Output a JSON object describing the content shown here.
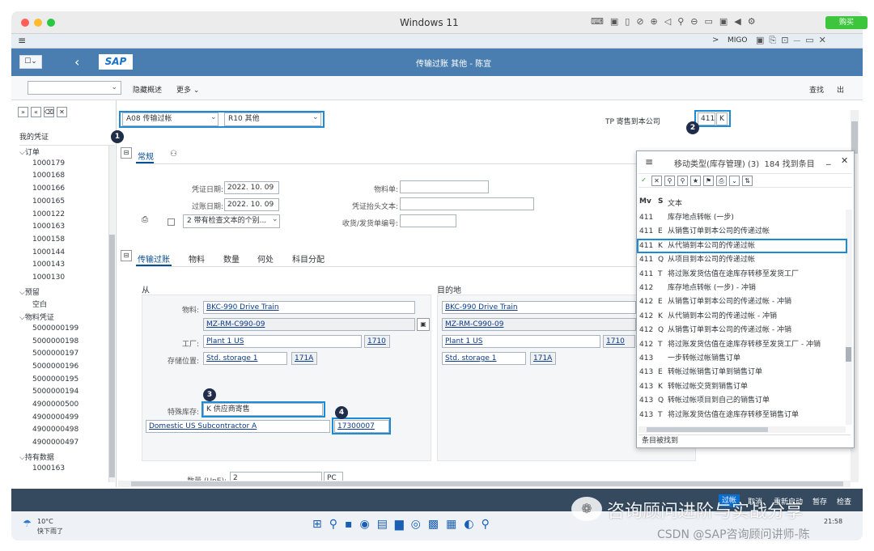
{
  "mac": {
    "title": "Windows 11",
    "buy_label": "购买"
  },
  "sapbar": {
    "tcode": "MIGO"
  },
  "header": {
    "title": "传输过账 其他 - 陈宜",
    "logo": "SAP"
  },
  "toolbar": {
    "hide_overview": "隐藏概述",
    "more": "更多",
    "find": "查找",
    "exit": "出"
  },
  "nav": {
    "title": "我的凭证",
    "groups": [
      {
        "label": "订单",
        "items": [
          "1000179",
          "1000168",
          "1000166",
          "1000165",
          "1000122",
          "1000163",
          "1000158",
          "1000144",
          "1000143",
          "1000130"
        ]
      },
      {
        "label": "预留",
        "items": [
          "空白"
        ]
      },
      {
        "label": "物料凭证",
        "items": [
          "5000000199",
          "5000000198",
          "5000000197",
          "5000000196",
          "5000000195",
          "5000000194",
          "4900000500",
          "4900000499",
          "4900000498",
          "4900000497"
        ]
      },
      {
        "label": "持有数据",
        "items": [
          "1000163"
        ]
      }
    ]
  },
  "action": {
    "transaction": "A08 传输过帐",
    "reference": "R10 其他",
    "tp_label": "TP 寄售到本公司",
    "mvt_type": "411",
    "special_stock": "K"
  },
  "header_tabs": {
    "general": "常规"
  },
  "fields": {
    "doc_date_label": "凭证日期:",
    "doc_date": "2022. 10. 09",
    "post_date_label": "过账日期:",
    "post_date": "2022. 10. 09",
    "material_slip_label": "物料单:",
    "header_text_label": "凭证抬头文本:",
    "grgi_label": "收货/发货单编号:",
    "print_option": "2 带有检查文本的个别..."
  },
  "item_tabs": [
    "传输过账",
    "物料",
    "数量",
    "何处",
    "科目分配"
  ],
  "from": {
    "title": "从",
    "material_label": "物料:",
    "material": "BKC-990 Drive Train",
    "material_code": "MZ-RM-C990-09",
    "plant_label": "工厂:",
    "plant": "Plant 1 US",
    "plant_code": "1710",
    "sloc_label": "存储位置:",
    "sloc": "Std. storage 1",
    "sloc_code": "171A",
    "special_stock_label": "特殊库存:",
    "special_stock": "K",
    "special_stock_text": "供应商寄售",
    "vendor_name": "Domestic US Subcontractor A",
    "vendor_code": "17300007"
  },
  "to": {
    "title": "目的地",
    "material": "BKC-990 Drive Train",
    "material_code": "MZ-RM-C990-09",
    "plant": "Plant 1 US",
    "plant_code": "1710",
    "sloc": "Std. storage 1",
    "sloc_code": "171A"
  },
  "quantity": {
    "label": "数量 (UnE):",
    "value": "2",
    "unit": "PC"
  },
  "dropdown": {
    "title": "移动类型(库存管理) (3)",
    "found": "184 找到条目",
    "col_mv": "Mv",
    "col_s": "S",
    "col_text": "文本",
    "rows": [
      {
        "mv": "411",
        "s": "",
        "text": "库存地点转帐 (一步)"
      },
      {
        "mv": "411",
        "s": "E",
        "text": "从销售订单到本公司的传递过帐"
      },
      {
        "mv": "411",
        "s": "K",
        "text": "从代销到本公司的传递过帐"
      },
      {
        "mv": "411",
        "s": "Q",
        "text": "从项目到本公司的传递过帐"
      },
      {
        "mv": "411",
        "s": "T",
        "text": "将过账发货估值在途库存转移至发货工厂"
      },
      {
        "mv": "412",
        "s": "",
        "text": "库存地点转帐 (一步) - 冲销"
      },
      {
        "mv": "412",
        "s": "E",
        "text": "从销售订单到本公司的传递过帐 - 冲销"
      },
      {
        "mv": "412",
        "s": "K",
        "text": "从代销到本公司的传递过帐 - 冲销"
      },
      {
        "mv": "412",
        "s": "Q",
        "text": "从销售订单到本公司的传递过帐 - 冲销"
      },
      {
        "mv": "412",
        "s": "T",
        "text": "将过账发货估值在途库存转移至发货工厂 - 冲销"
      },
      {
        "mv": "413",
        "s": "",
        "text": "一步转帐过帐销售订单"
      },
      {
        "mv": "413",
        "s": "E",
        "text": "转帐过帐销售订单到销售订单"
      },
      {
        "mv": "413",
        "s": "K",
        "text": "转帐过帐交货到销售订单"
      },
      {
        "mv": "413",
        "s": "Q",
        "text": "转帐过帐项目到自己的销售订单"
      },
      {
        "mv": "413",
        "s": "T",
        "text": "将过账发货估值在途库存转移至销售订单"
      }
    ],
    "status": "条目被找到"
  },
  "footer": {
    "check": "过帐",
    "cancel": "取消",
    "re_read": "重新启动",
    "hold": "暂存",
    "inspect": "检查"
  },
  "taskbar": {
    "temp": "10°C",
    "weather": "快下雨了",
    "time": "21:58"
  },
  "watermark": {
    "line1": "咨询顾问进阶与实战分享",
    "line2": "CSDN @SAP咨询顾问讲师-陈"
  },
  "badges": [
    "1",
    "2",
    "3",
    "4"
  ],
  "colors": {
    "accent": "#1b8bd8",
    "shell": "#354a5f",
    "badge": "#1f2d4a",
    "buy": "#3ec53e"
  }
}
